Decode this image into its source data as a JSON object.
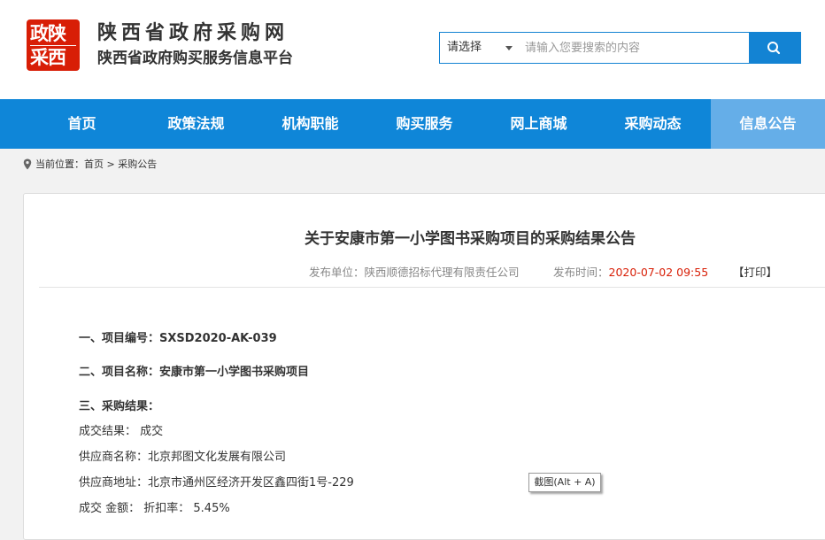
{
  "logo": {
    "line1": "政陕",
    "line2": "采西"
  },
  "site": {
    "title": "陕西省政府采购网",
    "subtitle": "陕西省政府购买服务信息平台"
  },
  "search": {
    "select_label": "请选择",
    "placeholder": "请输入您要搜索的内容",
    "button_icon": "search-icon"
  },
  "nav": {
    "items": [
      "首页",
      "政策法规",
      "机构职能",
      "购买服务",
      "网上商城",
      "采购动态",
      "信息公告"
    ],
    "active": "信息公告"
  },
  "breadcrumb": {
    "label": "当前位置：",
    "home": "首页",
    "sep": ">",
    "current": "采购公告"
  },
  "article": {
    "title": "关于安康市第一小学图书采购项目的采购结果公告",
    "publisher_label": "发布单位：",
    "publisher": "陕西顺德招标代理有限责任公司",
    "time_label": "发布时间：",
    "time": "2020-07-02 09:55",
    "print": "【打印】",
    "lines": [
      "一、项目编号：SXSD2020-AK-039",
      "二、项目名称：安康市第一小学图书采购项目",
      "三、采购结果：",
      "成交结果： 成交",
      "供应商名称：北京邦图文化发展有限公司",
      "供应商地址：北京市通州区经济开发区鑫四街1号-229",
      "成交 金额： 折扣率： 5.45%"
    ]
  },
  "tooltip": "截图(Alt + A)",
  "colors": {
    "brand_red": "#d81e06",
    "nav_blue": "#0f86d8",
    "nav_active": "#65aee8"
  }
}
